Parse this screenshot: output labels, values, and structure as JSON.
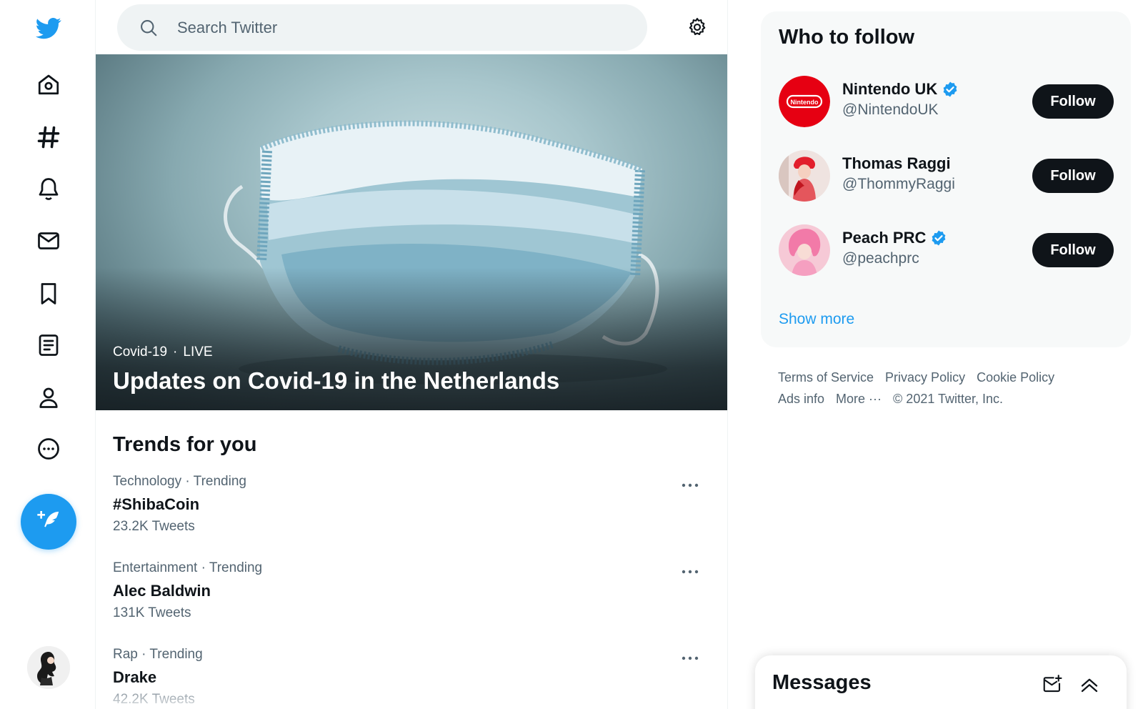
{
  "search": {
    "placeholder": "Search Twitter"
  },
  "hero": {
    "category": "Covid-19",
    "separator": "·",
    "status": "LIVE",
    "title": "Updates on Covid-19 in the Netherlands"
  },
  "trends": {
    "title": "Trends for you",
    "items": [
      {
        "meta": "Technology · Trending",
        "name": "#ShibaCoin",
        "count": "23.2K Tweets"
      },
      {
        "meta": "Entertainment · Trending",
        "name": "Alec Baldwin",
        "count": "131K Tweets"
      },
      {
        "meta": "Rap · Trending",
        "name": "Drake",
        "count": "42.2K Tweets"
      }
    ]
  },
  "who_to_follow": {
    "title": "Who to follow",
    "users": [
      {
        "name": "Nintendo UK",
        "handle": "@NintendoUK",
        "verified": true,
        "button": "Follow",
        "avatar_text": "Nintendo"
      },
      {
        "name": "Thomas Raggi",
        "handle": "@ThommyRaggi",
        "verified": false,
        "button": "Follow"
      },
      {
        "name": "Peach PRC",
        "handle": "@peachprc",
        "verified": true,
        "button": "Follow"
      }
    ],
    "show_more": "Show more"
  },
  "footer": {
    "links": [
      "Terms of Service",
      "Privacy Policy",
      "Cookie Policy",
      "Ads info",
      "More ···",
      "© 2021 Twitter, Inc."
    ]
  },
  "messages": {
    "title": "Messages"
  },
  "colors": {
    "accent": "#1d9bf0",
    "text": "#0f1419",
    "muted": "#536471",
    "panel": "#f7f9f9",
    "nintendo_red": "#e60012"
  },
  "icons": {
    "nav": [
      "twitter-logo-icon",
      "home-icon",
      "hashtag-icon",
      "bell-icon",
      "mail-icon",
      "bookmark-icon",
      "list-icon",
      "profile-icon",
      "more-circle-icon",
      "compose-tweet-icon"
    ]
  }
}
